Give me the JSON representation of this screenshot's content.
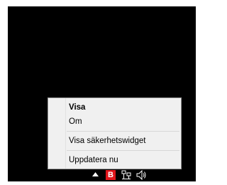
{
  "context_menu": {
    "items": [
      {
        "label": "Visa",
        "bold": true
      },
      {
        "label": "Om",
        "bold": false
      },
      {
        "label": "Visa säkerhetswidget",
        "bold": false
      },
      {
        "label": "Uppdatera nu",
        "bold": false
      }
    ]
  },
  "tray": {
    "icons": [
      "show-hidden-icons-arrow-icon",
      "bitdefender-icon",
      "network-icon",
      "volume-icon"
    ],
    "bitdefender_letter": "B"
  },
  "colors": {
    "desktop": "#000000",
    "menu_bg": "#f0f0f0",
    "bitdefender_red": "#e0151b"
  }
}
